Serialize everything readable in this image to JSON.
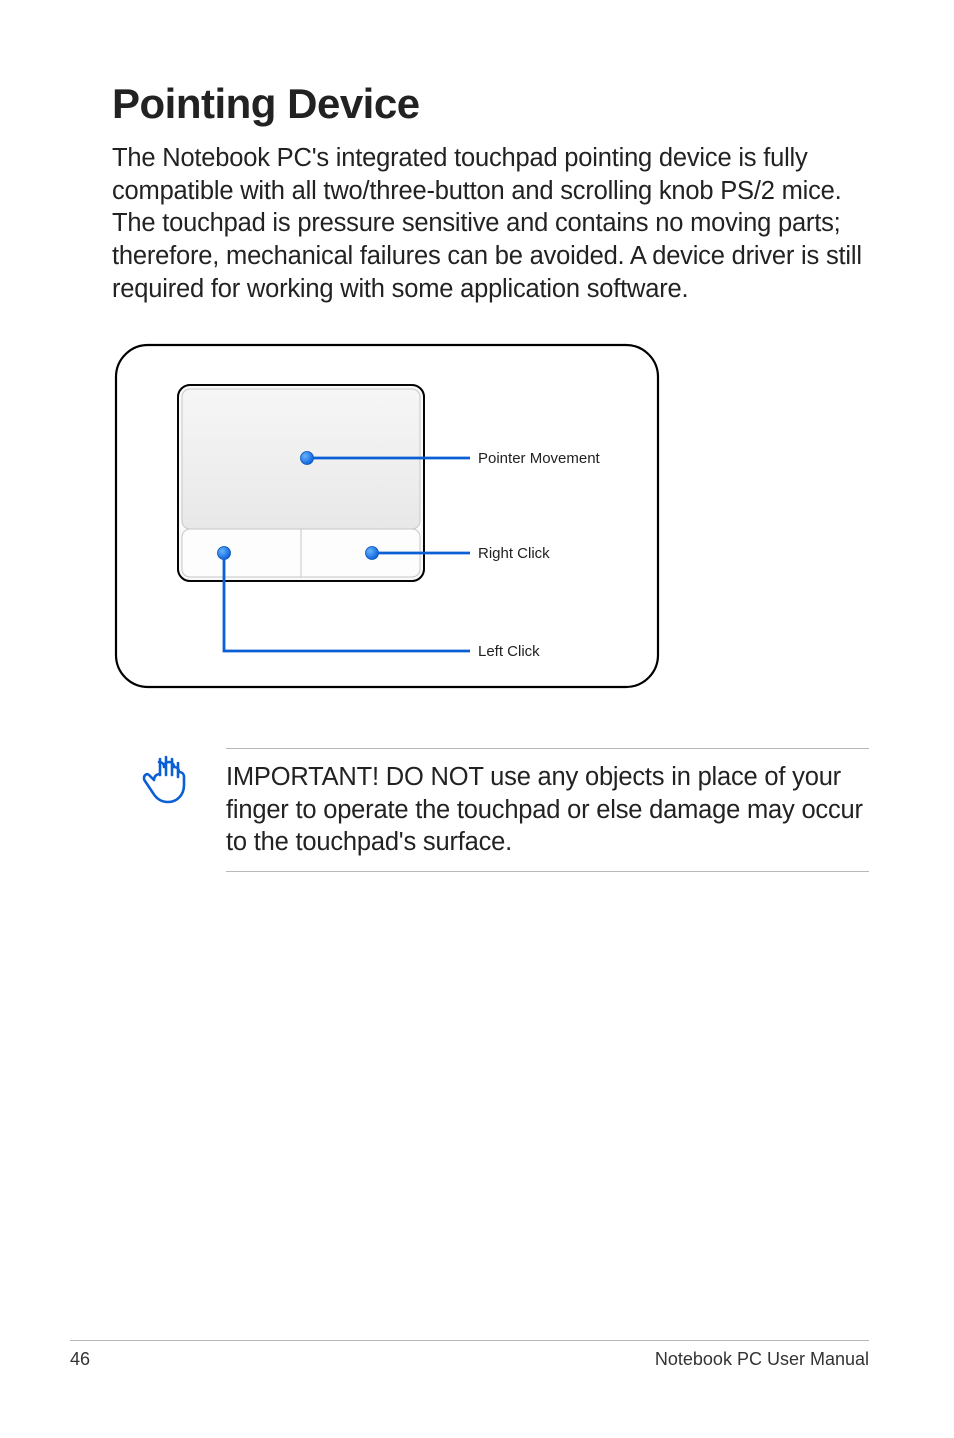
{
  "heading": "Pointing Device",
  "intro": "The Notebook PC's integrated touchpad pointing device is fully compatible with all two/three-button and scrolling knob PS/2 mice. The touchpad is pressure sensitive and contains no moving parts; therefore, mechanical failures can be avoided. A device driver is still required for working with some application software.",
  "diagram": {
    "label_pointer": "Pointer Movement",
    "label_right": "Right Click",
    "label_left": "Left Click"
  },
  "notice": "IMPORTANT! DO NOT use any objects in place of your finger to operate the touchpad or else damage may occur to the touchpad's surface.",
  "footer": {
    "page": "46",
    "title": "Notebook PC User Manual"
  }
}
